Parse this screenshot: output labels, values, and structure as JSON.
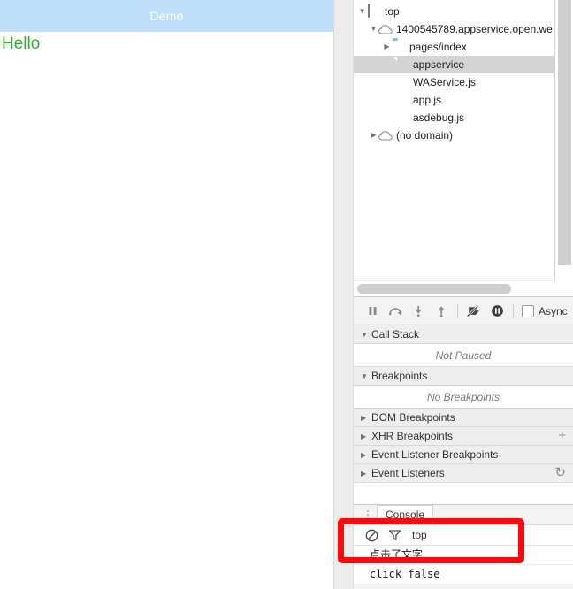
{
  "simulator": {
    "nav_title": "Demo",
    "page_text": "Hello"
  },
  "devtools": {
    "navigator": {
      "tree": [
        {
          "label": "top",
          "icon": "frame-icon",
          "twisty": "open",
          "indent": 0,
          "selected": false
        },
        {
          "label": "1400545789.appservice.open.we",
          "icon": "cloud-icon",
          "twisty": "open",
          "indent": 1,
          "selected": false
        },
        {
          "label": "pages/index",
          "icon": "folder-icon",
          "twisty": "closed",
          "indent": 2,
          "selected": false
        },
        {
          "label": "appservice",
          "icon": "document-icon",
          "twisty": "none",
          "indent": 2,
          "selected": true
        },
        {
          "label": "WAService.js",
          "icon": "js-file-icon",
          "twisty": "none",
          "indent": 2,
          "selected": false
        },
        {
          "label": "app.js",
          "icon": "js-file-icon",
          "twisty": "none",
          "indent": 2,
          "selected": false
        },
        {
          "label": "asdebug.js",
          "icon": "js-file-icon",
          "twisty": "none",
          "indent": 2,
          "selected": false
        },
        {
          "label": "(no domain)",
          "icon": "cloud-icon",
          "twisty": "closed",
          "indent": 1,
          "selected": false
        }
      ]
    },
    "debugger_toolbar": {
      "buttons": [
        {
          "name": "pause-resume-icon",
          "glyph": "pause"
        },
        {
          "name": "step-over-icon",
          "glyph": "step-over"
        },
        {
          "name": "step-into-icon",
          "glyph": "step-into"
        },
        {
          "name": "step-out-icon",
          "glyph": "step-out"
        },
        {
          "name": "deactivate-breakpoints-icon",
          "glyph": "deactivate"
        },
        {
          "name": "pause-on-exceptions-icon",
          "glyph": "pause-circle"
        }
      ],
      "async_label": "Async",
      "async_checked": false
    },
    "sidebar": {
      "sections": [
        {
          "name": "call-stack",
          "title": "Call Stack",
          "expanded": true,
          "empty_text": "Not Paused",
          "action": ""
        },
        {
          "name": "breakpoints",
          "title": "Breakpoints",
          "expanded": true,
          "empty_text": "No Breakpoints",
          "action": ""
        },
        {
          "name": "dom-breakpoints",
          "title": "DOM Breakpoints",
          "expanded": false,
          "empty_text": "",
          "action": ""
        },
        {
          "name": "xhr-breakpoints",
          "title": "XHR Breakpoints",
          "expanded": false,
          "empty_text": "",
          "action": "+"
        },
        {
          "name": "event-listener-breakpoints",
          "title": "Event Listener Breakpoints",
          "expanded": false,
          "empty_text": "",
          "action": ""
        },
        {
          "name": "event-listeners",
          "title": "Event Listeners",
          "expanded": false,
          "empty_text": "",
          "action": "↻"
        }
      ]
    },
    "drawer": {
      "tab_label": "Console",
      "toolbar": {
        "clear_icon": "clear-console-icon",
        "filter_icon": "filter-icon",
        "context": "top"
      },
      "messages": [
        {
          "text": "点击了文字"
        },
        {
          "text": "click false"
        }
      ]
    }
  },
  "annotation": {
    "highlight_color": "#fa0a0a"
  }
}
